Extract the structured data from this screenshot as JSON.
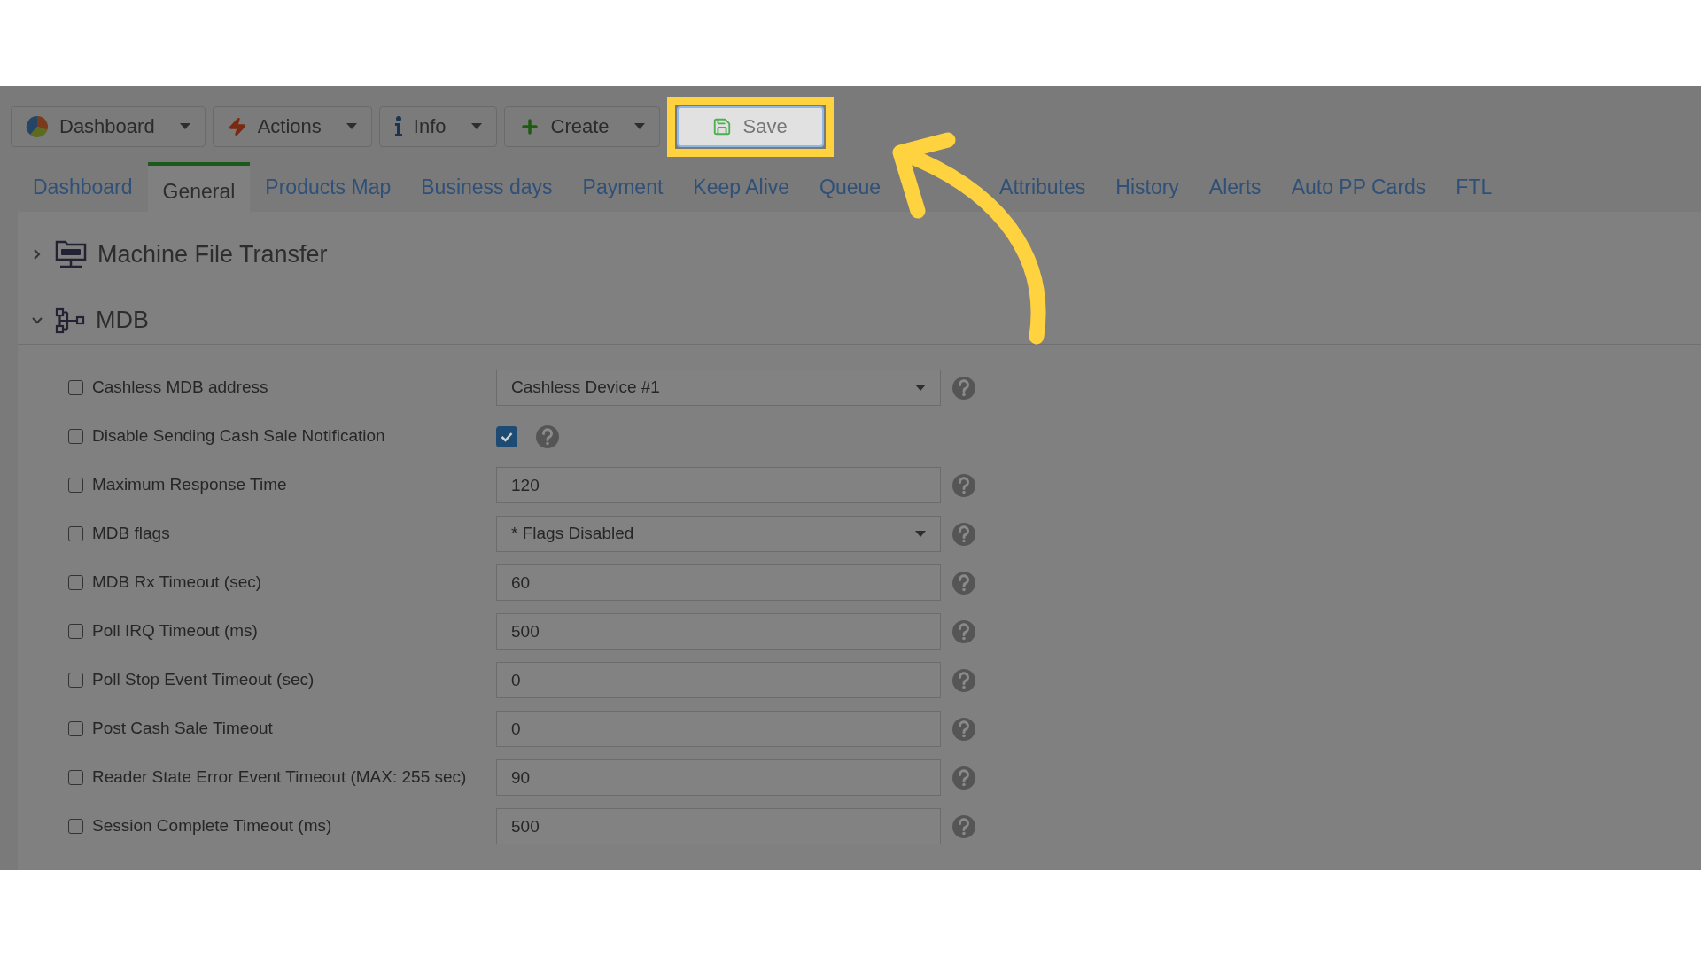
{
  "toolbar": [
    {
      "label": "Dashboard",
      "dropdown": true,
      "highlighted": false
    },
    {
      "label": "Actions",
      "dropdown": true,
      "highlighted": false
    },
    {
      "label": "Info",
      "dropdown": true,
      "highlighted": false
    },
    {
      "label": "Create",
      "dropdown": true,
      "highlighted": false
    },
    {
      "label": "Save",
      "dropdown": false,
      "highlighted": true
    }
  ],
  "tabs": [
    {
      "label": "Dashboard",
      "selected": false
    },
    {
      "label": "General",
      "selected": true
    },
    {
      "label": "Products Map",
      "selected": false
    },
    {
      "label": "Business days",
      "selected": false
    },
    {
      "label": "Payment",
      "selected": false
    },
    {
      "label": "Keep Alive",
      "selected": false
    },
    {
      "label": "Queue",
      "selected": false
    },
    {
      "label": "Attributes",
      "selected": false
    },
    {
      "label": "History",
      "selected": false
    },
    {
      "label": "Alerts",
      "selected": false
    },
    {
      "label": "Auto PP Cards",
      "selected": false
    },
    {
      "label": "FTL",
      "selected": false
    }
  ],
  "sections": [
    {
      "title": "Machine File Transfer",
      "expanded": false
    },
    {
      "title": "MDB",
      "expanded": true
    }
  ],
  "settings": [
    {
      "label": "Cashless MDB address",
      "checked": false,
      "kind": "select",
      "value": "Cashless Device #1"
    },
    {
      "label": "Disable Sending Cash Sale Notification",
      "checked": false,
      "kind": "checkbox",
      "on": true
    },
    {
      "label": "Maximum Response Time",
      "checked": false,
      "kind": "text",
      "value": "120"
    },
    {
      "label": "MDB flags",
      "checked": false,
      "kind": "select",
      "value": "* Flags Disabled"
    },
    {
      "label": "MDB Rx Timeout (sec)",
      "checked": false,
      "kind": "text",
      "value": "60"
    },
    {
      "label": "Poll IRQ Timeout (ms)",
      "checked": false,
      "kind": "text",
      "value": "500"
    },
    {
      "label": "Poll Stop Event Timeout (sec)",
      "checked": false,
      "kind": "text",
      "value": "0"
    },
    {
      "label": "Post Cash Sale Timeout",
      "checked": false,
      "kind": "text",
      "value": "0"
    },
    {
      "label": "Reader State Error Event Timeout (MAX: 255 sec)",
      "checked": false,
      "kind": "text",
      "value": "90"
    },
    {
      "label": "Session Complete Timeout (ms)",
      "checked": false,
      "kind": "text",
      "value": "500"
    }
  ]
}
